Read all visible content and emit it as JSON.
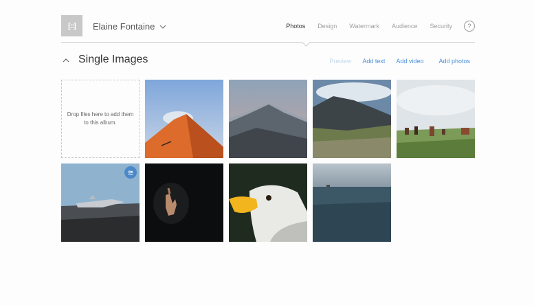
{
  "header": {
    "logo_glyph": "[::]",
    "user_name": "Elaine Fontaine",
    "nav": [
      {
        "label": "Photos",
        "active": true
      },
      {
        "label": "Design",
        "active": false
      },
      {
        "label": "Watermark",
        "active": false
      },
      {
        "label": "Audience",
        "active": false
      },
      {
        "label": "Security",
        "active": false
      }
    ],
    "help_label": "?"
  },
  "section": {
    "title": "Single Images",
    "actions": {
      "preview": "Preview",
      "add_text": "Add text",
      "add_video": "Add video",
      "add_photos": "Add photos"
    }
  },
  "dropzone": {
    "text": "Drop files here to add them to this album."
  },
  "photos": [
    {
      "name": "desert-dune-photo",
      "subject": "orange sand dune with sky"
    },
    {
      "name": "mountain-peak-photo",
      "subject": "snowy mountain at dusk"
    },
    {
      "name": "cloudy-ridge-photo",
      "subject": "green valley with cloudy ridge"
    },
    {
      "name": "horses-field-photo",
      "subject": "horses grazing on grassland"
    },
    {
      "name": "plane-wreck-photo",
      "subject": "plane wreck on black sand beach",
      "badge": "≋"
    },
    {
      "name": "dark-hand-photo",
      "subject": "hand emerging from dark"
    },
    {
      "name": "eagle-photo",
      "subject": "bald eagle head"
    },
    {
      "name": "ocean-photo",
      "subject": "open ocean and horizon"
    }
  ],
  "colors": {
    "accent": "#4a90d9",
    "badge": "#4a88c8",
    "divider": "#cfcfcf"
  }
}
